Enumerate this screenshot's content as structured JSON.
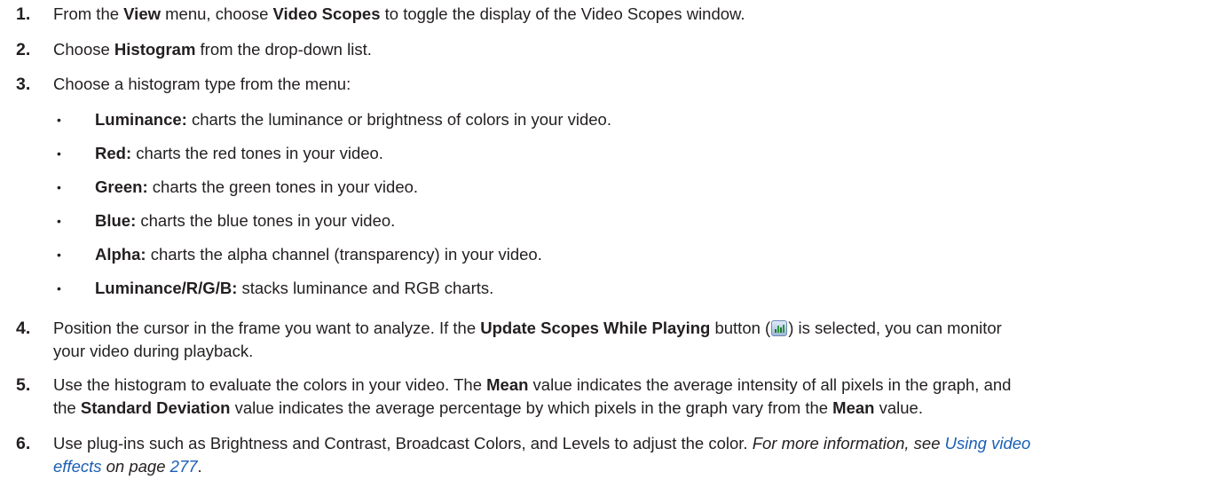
{
  "steps": [
    {
      "number": "1.",
      "parts": [
        "From the ",
        "View",
        " menu, choose ",
        "Video Scopes",
        " to toggle the display of the Video Scopes window."
      ]
    },
    {
      "number": "2.",
      "parts": [
        "Choose ",
        "Histogram",
        " from the drop-down list."
      ]
    },
    {
      "number": "3.",
      "text": "Choose a histogram type from the menu:",
      "bullets": [
        {
          "term": "Luminance:",
          "desc": " charts the luminance or brightness of colors in your video."
        },
        {
          "term": "Red:",
          "desc": " charts the red tones in your video."
        },
        {
          "term": "Green:",
          "desc": " charts the green tones in your video."
        },
        {
          "term": "Blue:",
          "desc": " charts the blue tones in your video."
        },
        {
          "term": "Alpha:",
          "desc": " charts the alpha channel (transparency) in your video."
        },
        {
          "term": "Luminance/R/G/B:",
          "desc": " stacks luminance and RGB charts."
        }
      ]
    },
    {
      "number": "4.",
      "line1_a": "Position the cursor in the frame you want to analyze. If the ",
      "line1_bold": "Update Scopes While Playing",
      "line1_b": " button (",
      "line1_c": ") is selected, you can monitor",
      "line2": "your video during playback.",
      "icon": "update-scopes-while-playing-icon"
    },
    {
      "number": "5.",
      "line1_a": "Use the histogram to evaluate the colors in your video. The ",
      "line1_bold": "Mean",
      "line1_b": " value indicates the average intensity of all pixels in the graph, and",
      "line2_a": "the ",
      "line2_bold1": "Standard Deviation",
      "line2_b": " value indicates the average percentage by which pixels in the graph vary from the ",
      "line2_bold2": "Mean",
      "line2_c": " value."
    },
    {
      "number": "6.",
      "line1_a": "Use plug-ins such as Brightness and Contrast, Broadcast Colors, and Levels to adjust the color. ",
      "line1_italic": "For more information, see ",
      "line1_link": "Using video",
      "line2_link": "effects",
      "line2_italic": " on page ",
      "line2_page": "277",
      "line2_end": "."
    }
  ],
  "colors": {
    "text": "#231f20",
    "link": "#1a5fb4"
  }
}
